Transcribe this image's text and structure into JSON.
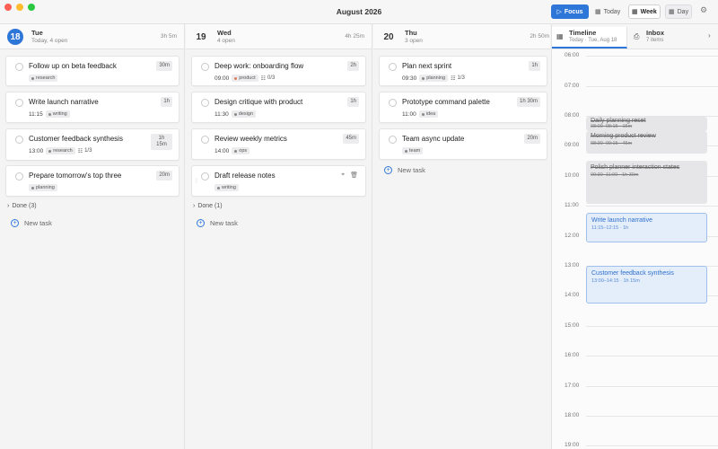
{
  "window": {
    "title": "August 2026"
  },
  "toolbar": {
    "focus_label": "Focus",
    "today_label": "Today",
    "week_label": "Week",
    "day_label": "Day"
  },
  "days": [
    {
      "num": "18",
      "name": "Tue",
      "sub": "Today, 4 open",
      "dur": "3h 5m",
      "tasks": [
        {
          "title": "Follow up on beta feedback",
          "dur": "30m",
          "tag": "research",
          "tag_color": "#a0a0a5"
        },
        {
          "title": "Write launch narrative",
          "dur": "1h",
          "time": "11:15",
          "tag": "writing",
          "tag_color": "#a0a0a5"
        },
        {
          "title": "Customer feedback synthesis",
          "dur": "1h 15m",
          "time": "13:00",
          "tag": "research",
          "tag_color": "#a0a0a5",
          "sub": "1/3"
        },
        {
          "title": "Prepare tomorrow's top three",
          "dur": "20m",
          "tag": "planning",
          "tag_color": "#a0a0a5"
        }
      ],
      "done": "Done (3)",
      "new_task": "New task"
    },
    {
      "num": "19",
      "name": "Wed",
      "sub": "4 open",
      "dur": "4h 25m",
      "tasks": [
        {
          "title": "Deep work: onboarding flow",
          "dur": "2h",
          "time": "09:00",
          "tag": "product",
          "tag_color": "#e07b5b",
          "sub": "0/3"
        },
        {
          "title": "Design critique with product",
          "dur": "1h",
          "time": "11:30",
          "tag": "design",
          "tag_color": "#a0a0a5"
        },
        {
          "title": "Review weekly metrics",
          "dur": "45m",
          "time": "14:00",
          "tag": "ops",
          "tag_color": "#a0a0a5"
        },
        {
          "title": "Draft release notes",
          "tag": "writing",
          "tag_color": "#a0a0a5"
        }
      ],
      "done": "Done (1)",
      "new_task": "New task"
    },
    {
      "num": "20",
      "name": "Thu",
      "sub": "3 open",
      "dur": "2h 50m",
      "tasks": [
        {
          "title": "Plan next sprint",
          "dur": "1h",
          "time": "09:30",
          "tag": "planning",
          "tag_color": "#a0a0a5",
          "sub": "1/3"
        },
        {
          "title": "Prototype command palette",
          "dur": "1h 30m",
          "time": "11:00",
          "tag": "idea",
          "tag_color": "#a0a0a5"
        },
        {
          "title": "Team async update",
          "dur": "20m",
          "tag": "team",
          "tag_color": "#a0a0a5"
        }
      ],
      "new_task": "New task"
    }
  ],
  "panel": {
    "timeline_tab": {
      "name": "Timeline",
      "sub": "Today · Tue, Aug 18"
    },
    "inbox_tab": {
      "name": "Inbox",
      "sub": "7 items"
    },
    "hours": [
      "06:00",
      "07:00",
      "08:00",
      "09:00",
      "10:00",
      "11:00",
      "12:00",
      "13:00",
      "14:00",
      "15:00",
      "16:00",
      "17:00",
      "18:00",
      "19:00"
    ],
    "events": [
      {
        "title": "Daily planning reset",
        "time": "08:00–08:15 · 15m",
        "style": "gray"
      },
      {
        "title": "Morning product review",
        "time": "08:30–09:15 · 45m",
        "style": "gray"
      },
      {
        "title": "Polish planner interaction states",
        "time": "09:30–11:00 · 1h 30m",
        "style": "gray"
      },
      {
        "title": "Write launch narrative",
        "time": "11:15–12:15 · 1h",
        "style": "blue"
      },
      {
        "title": "Customer feedback synthesis",
        "time": "13:00–14:15 · 1h 15m",
        "style": "blue"
      }
    ]
  }
}
